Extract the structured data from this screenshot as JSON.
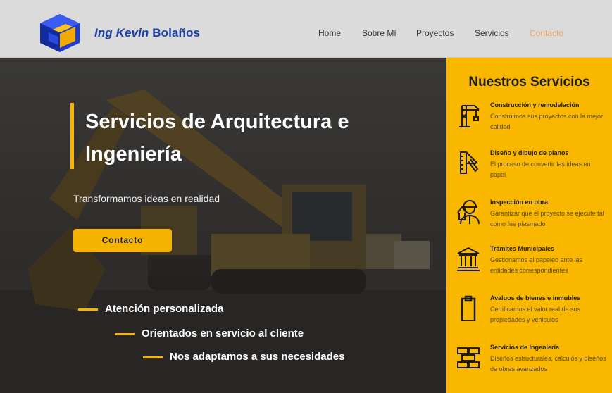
{
  "header": {
    "brand_italic": "Ing Kevin",
    "brand_rest": "Bolaños",
    "nav": [
      "Home",
      "Sobre Mí",
      "Proyectos",
      "Servicios",
      "Contacto"
    ]
  },
  "hero": {
    "title": "Servicios de Arquitectura e Ingeniería",
    "subtitle": "Transformamos ideas en realidad",
    "cta": "Contacto",
    "features": [
      "Atención personalizada",
      "Orientados en servicio al cliente",
      "Nos adaptamos a sus necesidades"
    ]
  },
  "services": {
    "title": "Nuestros Servicios",
    "items": [
      {
        "name": "Construcción y remodelación",
        "desc": "Construimos sus proyectos con la mejor calidad",
        "icon": "crane-icon"
      },
      {
        "name": "Diseño y dibujo de planos",
        "desc": "El proceso de convertir las ideas en papel",
        "icon": "ruler-icon"
      },
      {
        "name": "Inspección en obra",
        "desc": "Garantizar que el proyecto se ejecute tal como fue plasmado",
        "icon": "worker-icon"
      },
      {
        "name": "Trámites Municipales",
        "desc": "Gestionamos el papeleo ante las entidades correspondientes",
        "icon": "building-icon"
      },
      {
        "name": "Avaluos de bienes e inmubles",
        "desc": "Certificamos el valor real de sus propiedades y vehiculos",
        "icon": "clipboard-icon"
      },
      {
        "name": "Servicios de Ingeniería",
        "desc": "Diseños estructurales, cálculos y diseños de obras avanzados",
        "icon": "bricks-icon"
      }
    ]
  },
  "colors": {
    "accent": "#f9b700",
    "brand_blue": "#1b3fa8",
    "nav_active": "#f2a15a"
  }
}
